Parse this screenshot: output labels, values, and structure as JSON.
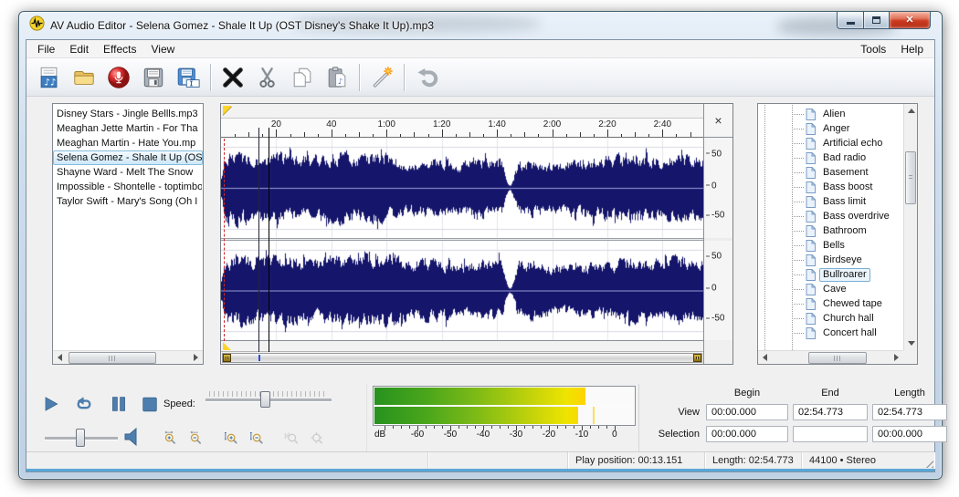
{
  "window": {
    "title": "AV Audio Editor - Selena Gomez - Shale It Up (OST Disney's Shake It Up).mp3"
  },
  "menu": {
    "items": [
      "File",
      "Edit",
      "Effects",
      "View"
    ],
    "right_items": [
      "Tools",
      "Help"
    ]
  },
  "toolbar": {
    "buttons": [
      "new-audio-file",
      "open-file",
      "record",
      "save",
      "save-as",
      "delete",
      "cut",
      "copy",
      "paste",
      "apply-effect-wand",
      "undo"
    ]
  },
  "playlist": {
    "items": [
      "Disney Stars - Jingle Bellls.mp3",
      "Meaghan Jette Martin - For Tha",
      "Meaghan Martin - Hate You.mp",
      "Selena Gomez - Shale It Up (OS",
      "Shayne Ward - Melt The Snow",
      "Impossible - Shontelle - toptimbo",
      "Taylor Swift - Mary's Song (Oh I"
    ],
    "selected_index": 3
  },
  "waveform": {
    "duration_s": 174.773,
    "play_position_s": 13.151,
    "cue_position_s": 17.1,
    "close_button": "×",
    "ruler_ticks": [
      {
        "s": 20,
        "label": "20"
      },
      {
        "s": 40,
        "label": "40"
      },
      {
        "s": 60,
        "label": "1:00"
      },
      {
        "s": 80,
        "label": "1:20"
      },
      {
        "s": 100,
        "label": "1:40"
      },
      {
        "s": 120,
        "label": "2:00"
      },
      {
        "s": 140,
        "label": "2:20"
      },
      {
        "s": 160,
        "label": "2:40"
      }
    ],
    "scale_labels": [
      "50",
      "0",
      "-50"
    ]
  },
  "effects": {
    "items": [
      "Alien",
      "Anger",
      "Artificial echo",
      "Bad radio",
      "Basement",
      "Bass boost",
      "Bass limit",
      "Bass overdrive",
      "Bathroom",
      "Bells",
      "Birdseye",
      "Bullroarer",
      "Cave",
      "Chewed tape",
      "Church hall",
      "Concert hall"
    ],
    "selected_index": 11
  },
  "transport": {
    "speed_label": "Speed:"
  },
  "meter": {
    "unit_label": "dB",
    "ticks": [
      {
        "db": -60,
        "label": "-60"
      },
      {
        "db": -50,
        "label": "-50"
      },
      {
        "db": -40,
        "label": "-40"
      },
      {
        "db": -30,
        "label": "-30"
      },
      {
        "db": -20,
        "label": "-20"
      },
      {
        "db": -10,
        "label": "-10"
      },
      {
        "db": 0,
        "label": "0"
      }
    ],
    "level_left_pct": 81.5,
    "level_right_pct": 78.5,
    "peak_pct": 84
  },
  "position_panel": {
    "headers": [
      "Begin",
      "End",
      "Length"
    ],
    "rows": [
      {
        "label": "View",
        "begin": "00:00.000",
        "end": "02:54.773",
        "length": "02:54.773"
      },
      {
        "label": "Selection",
        "begin": "00:00.000",
        "end": "",
        "length": "00:00.000"
      }
    ]
  },
  "statusbar": {
    "panels": [
      "",
      "",
      "Play position: 00:13.151",
      "Length: 02:54.773",
      "44100 • Stereo"
    ]
  }
}
